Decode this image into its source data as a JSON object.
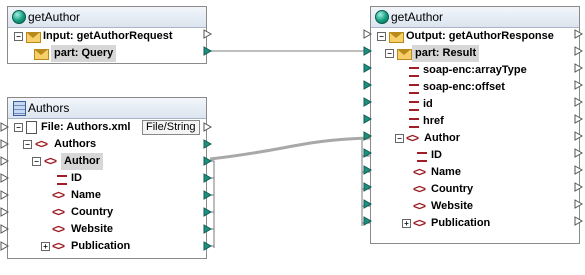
{
  "left_top": {
    "title": "getAuthor",
    "input_label": "Input: getAuthorRequest",
    "part_label": "part: Query"
  },
  "authors": {
    "title": "Authors",
    "file_label": "File: Authors.xml",
    "file_button": "File/String",
    "root": "Authors",
    "author": "Author",
    "children": [
      "ID",
      "Name",
      "Country",
      "Website",
      "Publication"
    ]
  },
  "right": {
    "title": "getAuthor",
    "output_label": "Output: getAuthorResponse",
    "part_label": "part: Result",
    "attrs": [
      "soap-enc:arrayType",
      "soap-enc:offset",
      "id",
      "href"
    ],
    "author": "Author",
    "children": [
      "ID",
      "Name",
      "Country",
      "Website",
      "Publication"
    ]
  },
  "colors": {
    "connection": "#a8a8a8",
    "element_icon": "#9b1b22",
    "connector": "#1f8f7f"
  }
}
